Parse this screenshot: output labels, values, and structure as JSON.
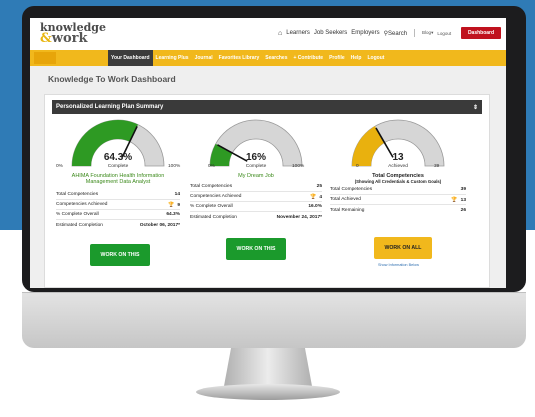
{
  "header": {
    "logo_line1": "knowledge",
    "logo_amp": "&",
    "logo_line2": "work",
    "nav": [
      "Learners",
      "Job Seekers",
      "Employers"
    ],
    "search_label": "Search",
    "blog_label": "Blog",
    "logout_label": "Logout",
    "dashboard_button": "Dashboard"
  },
  "main_nav": {
    "badge": "",
    "items": [
      "Your Dashboard",
      "Learning Plus",
      "Journal",
      "Favorites Library",
      "Searches",
      "+ Contribute",
      "Profile",
      "Help",
      "Logout"
    ]
  },
  "page": {
    "title": "Knowledge To Work Dashboard",
    "panel_title": "Personalized Learning Plan Summary"
  },
  "gauges": [
    {
      "value_label": "64.3%",
      "fraction": 0.643,
      "sub_label": "Complete",
      "min_label": "0%",
      "max_label": "100%",
      "color": "#2e9a23",
      "title": "AHIMA Foundation Health Information Management Data Analyst",
      "stats": [
        {
          "label": "Total Competencies",
          "value": "14",
          "trophy": false
        },
        {
          "label": "Competencies Achieved",
          "value": "9",
          "trophy": true
        },
        {
          "label": "% Complete Overall",
          "value": "64.3%",
          "trophy": false
        },
        {
          "label": "Estimated Completion",
          "value": "October 06, 2017*",
          "trophy": false
        }
      ],
      "button": "WORK ON THIS"
    },
    {
      "value_label": "16%",
      "fraction": 0.16,
      "sub_label": "Complete",
      "min_label": "0%",
      "max_label": "100%",
      "color": "#2e9a23",
      "title": "My Dream Job",
      "stats": [
        {
          "label": "Total Competencies",
          "value": "25",
          "trophy": false
        },
        {
          "label": "Competencies Achieved",
          "value": "4",
          "trophy": true
        },
        {
          "label": "% Complete Overall",
          "value": "16.0%",
          "trophy": false
        },
        {
          "label": "Estimated Completion",
          "value": "November 24, 2017*",
          "trophy": false
        }
      ],
      "button": "WORK ON THIS"
    },
    {
      "value_label": "13",
      "fraction": 0.333,
      "sub_label": "Achieved",
      "min_label": "0",
      "max_label": "39",
      "color": "#e9b10e",
      "title": "Total Competencies",
      "subtitle": "(Showing All Credentials & Custom Goals)",
      "stats": [
        {
          "label": "Total Competencies",
          "value": "39",
          "trophy": false
        },
        {
          "label": "Total Achieved",
          "value": "13",
          "trophy": true
        },
        {
          "label": "Total Remaining",
          "value": "26",
          "trophy": false
        }
      ],
      "button": "WORK ON ALL",
      "link": "Show Information Below"
    }
  ]
}
